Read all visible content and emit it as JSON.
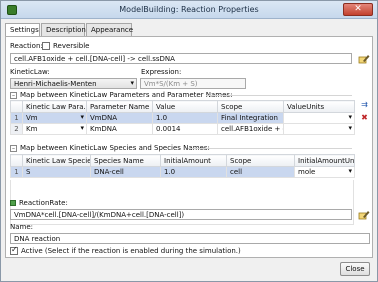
{
  "window": {
    "title": "ModelBuilding: Reaction Properties",
    "close_glyph": "✕"
  },
  "tabs": [
    "Settings",
    "Description",
    "Appearance"
  ],
  "reaction": {
    "label": "Reaction:",
    "reversible_label": "Reversible",
    "reversible_checked": false,
    "equation": "cell.AFB1oxide + cell.[DNA-cell] -> cell.ssDNA"
  },
  "kinetic_law": {
    "label": "KineticLaw:",
    "value": "Henri-Michaelis-Menten",
    "expression_label": "Expression:",
    "expression": "Vm*S/(Km + S)"
  },
  "params_section": {
    "title": "Map between KineticLaw Parameters and Parameter Names:",
    "columns": [
      "Kinetic Law Para...",
      "Parameter Name",
      "Value",
      "Scope",
      "ValueUnits"
    ],
    "rows": [
      {
        "num": "1",
        "law_param": "Vm",
        "name": "VmDNA",
        "value": "1.0",
        "scope": "Final Integration",
        "units": ""
      },
      {
        "num": "2",
        "law_param": "Km",
        "name": "KmDNA",
        "value": "0.0014",
        "scope": "cell.AFB1oxide + c...",
        "units": ""
      }
    ]
  },
  "species_section": {
    "title": "Map between KineticLaw Species and Species Names:",
    "columns": [
      "Kinetic Law Species",
      "Species Name",
      "InitialAmount",
      "Scope",
      "InitialAmountUnits"
    ],
    "rows": [
      {
        "num": "1",
        "law_species": "S",
        "name": "DNA-cell",
        "amount": "1.0",
        "scope": "cell",
        "units": "mole"
      }
    ]
  },
  "reaction_rate": {
    "label": "ReactionRate:",
    "value": "VmDNA*cell.[DNA-cell]/(KmDNA+cell.[DNA-cell])"
  },
  "name": {
    "label": "Name:",
    "value": "DNA reaction"
  },
  "active": {
    "checked": true,
    "label": "Active (Select if the reaction is enabled during the simulation.)"
  },
  "buttons": {
    "close": "Close"
  },
  "glyphs": {
    "expander": "–",
    "dropdown": "▾"
  },
  "colors": {
    "selection": "#c9d7ef",
    "titlebar": "#c6d8ec"
  }
}
